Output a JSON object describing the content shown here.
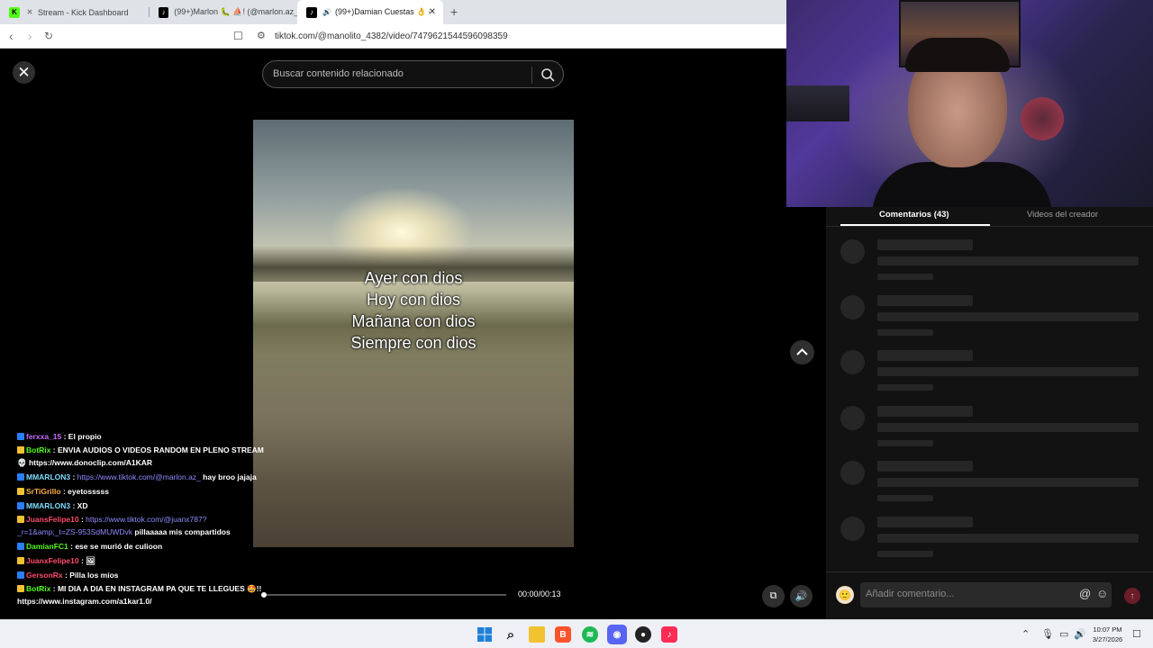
{
  "browser": {
    "tabs": [
      {
        "label": "Stream - Kick Dashboard",
        "icon": "kick-icon",
        "color": "#53fc18"
      },
      {
        "label": "(99+)Marlon 🐛 ⛵! (@marlon.az_) |",
        "icon": "tiktok-icon",
        "color": "#000000"
      },
      {
        "label": "(99+)Damian Cuestas 👌 (@",
        "icon": "tiktok-icon",
        "color": "#000000",
        "active": true
      }
    ],
    "url": "tiktok.com/@manolito_4382/video/7479621544596098359"
  },
  "video": {
    "search_placeholder": "Buscar contenido relacionado",
    "caption_lines": [
      "Ayer con dios",
      "Hoy con dios",
      "Mañana con dios",
      "Siempre con dios"
    ],
    "time": "00:00/00:13",
    "progress": 0.0
  },
  "chat": {
    "messages": [
      {
        "user": "ferxxa_15",
        "user_color": "#c86bff",
        "text": "El propio"
      },
      {
        "user": "BotRix",
        "user_color": "#53fc18",
        "text": "ENVIA AUDIOS O VIDEOS RANDOM EN PLENO STREAM 💀 https://www.donoclip.com/A1KAR",
        "wrap": true
      },
      {
        "user": "MMARLON3",
        "user_color": "#7fdcff",
        "link": "https://www.tiktok.com/@marlon.az_",
        "text": "hay broo jajaja"
      },
      {
        "user": "SrTiGrillo",
        "user_color": "#ffb347",
        "text": "eyetosssss"
      },
      {
        "user": "MMARLON3",
        "user_color": "#7fdcff",
        "text": "XD"
      },
      {
        "user": "JuansFelipe10",
        "user_color": "#ff4d6d",
        "link": "https://www.tiktok.com/@juanx787?_r=1&amp;_t=ZS-953SdMUWDvk",
        "text": "pillaaaaa mis compartidos",
        "wrap": true
      },
      {
        "user": "DamianFC1",
        "user_color": "#53fc18",
        "text": "ese se murió de culioon"
      },
      {
        "user": "JuanxFelipe10",
        "user_color": "#ff4d6d",
        "text": "🖼"
      },
      {
        "user": "GersonRx",
        "user_color": "#ff4d6d",
        "text": "Pilla los míos"
      },
      {
        "user": "BotRix",
        "user_color": "#53fc18",
        "text": "MI DIA A DIA EN INSTAGRAM PA QUE TE LLEGUES 🤩!! https://www.instagram.com/a1kar1.0/",
        "wrap": true
      }
    ]
  },
  "comments": {
    "tab_comments": "Comentarios (43)",
    "tab_creator": "Videos del creador",
    "placeholder": "Añadir comentario..."
  },
  "taskbar": {
    "time": "10:07 PM",
    "date": "3/27/2026"
  },
  "colors": {
    "accent": "#fe2c55",
    "kick_green": "#53fc18"
  }
}
